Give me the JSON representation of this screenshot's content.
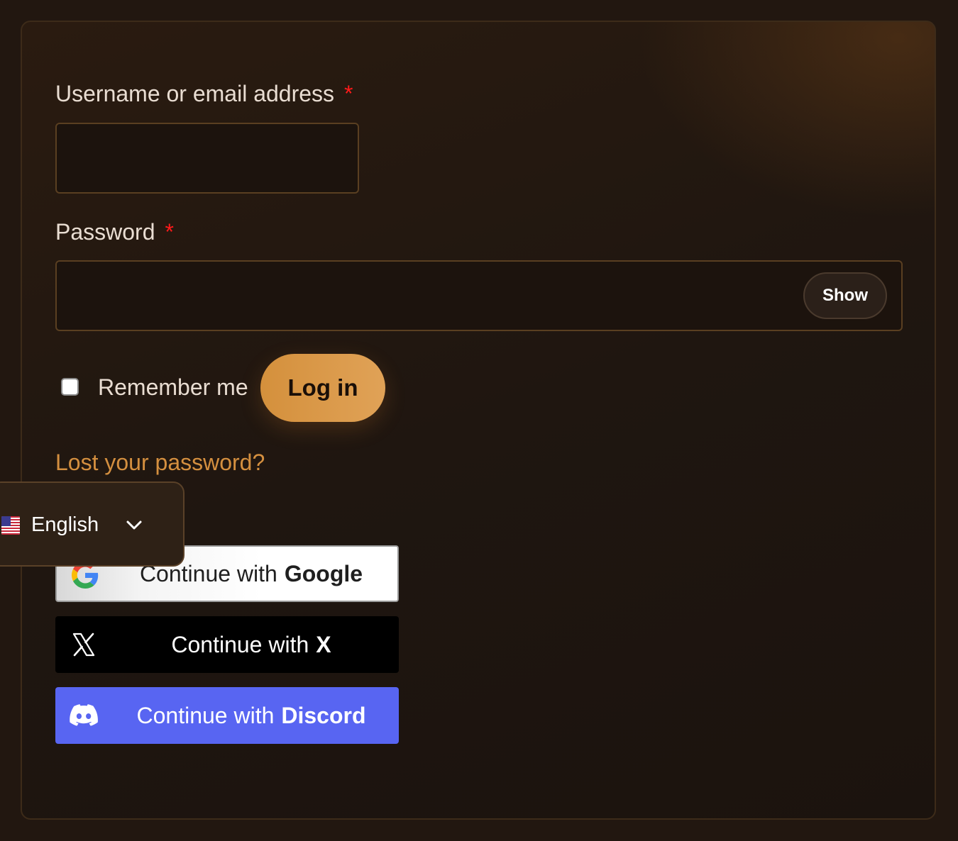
{
  "login_form": {
    "username_label": "Username or email address",
    "username_required_marker": "*",
    "password_label": "Password",
    "password_required_marker": "*",
    "show_password_label": "Show",
    "remember_me_label": "Remember me",
    "login_button_label": "Log in",
    "lost_password_link": "Lost your password?"
  },
  "language_switcher": {
    "selected_language": "English",
    "flag_icon": "us-flag-icon",
    "dropdown_icon": "chevron-down-icon"
  },
  "social_login": {
    "google": {
      "prefix": "Continue with",
      "provider": "Google",
      "icon": "google-icon"
    },
    "x": {
      "prefix": "Continue with",
      "provider": "X",
      "icon": "x-icon"
    },
    "discord": {
      "prefix": "Continue with",
      "provider": "Discord",
      "icon": "discord-icon",
      "color": "#5865f2"
    }
  },
  "colors": {
    "accent": "#d8953f",
    "required": "#ff1a1a",
    "link": "#d48f3f",
    "background": "#221710"
  }
}
